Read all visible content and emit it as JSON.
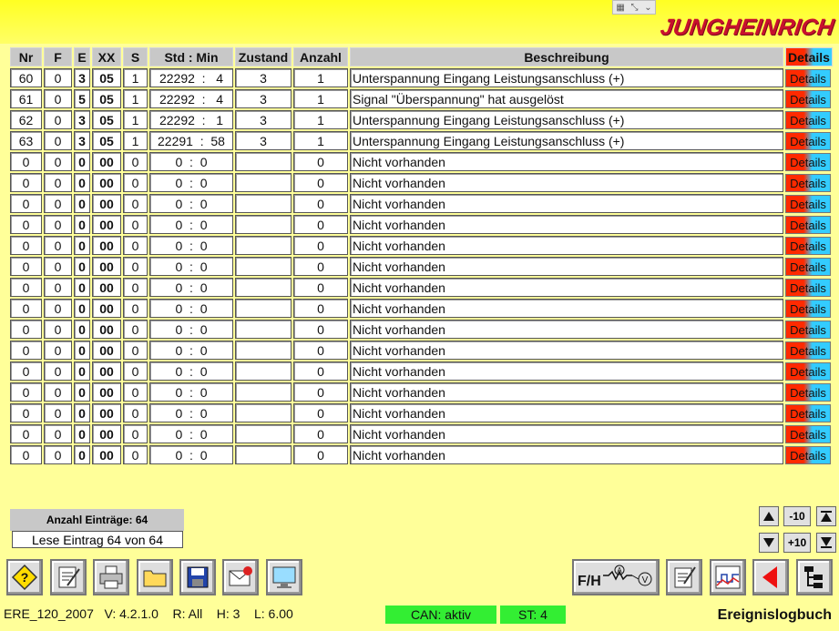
{
  "logo_text": "JUNGHEINRICH",
  "columns": {
    "nr": "Nr",
    "f": "F",
    "e": "E",
    "xx": "XX",
    "s": "S",
    "time": "Std : Min",
    "zustand": "Zustand",
    "anzahl": "Anzahl",
    "desc": "Beschreibung",
    "details": "Details"
  },
  "rows": [
    {
      "nr": "60",
      "f": "0",
      "e": "3",
      "xx": "05",
      "s": "1",
      "time": "22292  :   4",
      "zustand": "3",
      "anzahl": "1",
      "desc": "Unterspannung Eingang Leistungsanschluss (+)",
      "details": "Details"
    },
    {
      "nr": "61",
      "f": "0",
      "e": "5",
      "xx": "05",
      "s": "1",
      "time": "22292  :   4",
      "zustand": "3",
      "anzahl": "1",
      "desc": "Signal \"Überspannung\" hat ausgelöst",
      "details": "Details"
    },
    {
      "nr": "62",
      "f": "0",
      "e": "3",
      "xx": "05",
      "s": "1",
      "time": "22292  :   1",
      "zustand": "3",
      "anzahl": "1",
      "desc": "Unterspannung Eingang Leistungsanschluss (+)",
      "details": "Details"
    },
    {
      "nr": "63",
      "f": "0",
      "e": "3",
      "xx": "05",
      "s": "1",
      "time": "22291  :  58",
      "zustand": "3",
      "anzahl": "1",
      "desc": "Unterspannung Eingang Leistungsanschluss (+)",
      "details": "Details"
    },
    {
      "nr": "0",
      "f": "0",
      "e": "0",
      "xx": "00",
      "s": "0",
      "time": "0  :  0",
      "zustand": "",
      "anzahl": "0",
      "desc": "Nicht vorhanden",
      "details": "Details"
    },
    {
      "nr": "0",
      "f": "0",
      "e": "0",
      "xx": "00",
      "s": "0",
      "time": "0  :  0",
      "zustand": "",
      "anzahl": "0",
      "desc": "Nicht vorhanden",
      "details": "Details"
    },
    {
      "nr": "0",
      "f": "0",
      "e": "0",
      "xx": "00",
      "s": "0",
      "time": "0  :  0",
      "zustand": "",
      "anzahl": "0",
      "desc": "Nicht vorhanden",
      "details": "Details"
    },
    {
      "nr": "0",
      "f": "0",
      "e": "0",
      "xx": "00",
      "s": "0",
      "time": "0  :  0",
      "zustand": "",
      "anzahl": "0",
      "desc": "Nicht vorhanden",
      "details": "Details"
    },
    {
      "nr": "0",
      "f": "0",
      "e": "0",
      "xx": "00",
      "s": "0",
      "time": "0  :  0",
      "zustand": "",
      "anzahl": "0",
      "desc": "Nicht vorhanden",
      "details": "Details"
    },
    {
      "nr": "0",
      "f": "0",
      "e": "0",
      "xx": "00",
      "s": "0",
      "time": "0  :  0",
      "zustand": "",
      "anzahl": "0",
      "desc": "Nicht vorhanden",
      "details": "Details"
    },
    {
      "nr": "0",
      "f": "0",
      "e": "0",
      "xx": "00",
      "s": "0",
      "time": "0  :  0",
      "zustand": "",
      "anzahl": "0",
      "desc": "Nicht vorhanden",
      "details": "Details"
    },
    {
      "nr": "0",
      "f": "0",
      "e": "0",
      "xx": "00",
      "s": "0",
      "time": "0  :  0",
      "zustand": "",
      "anzahl": "0",
      "desc": "Nicht vorhanden",
      "details": "Details"
    },
    {
      "nr": "0",
      "f": "0",
      "e": "0",
      "xx": "00",
      "s": "0",
      "time": "0  :  0",
      "zustand": "",
      "anzahl": "0",
      "desc": "Nicht vorhanden",
      "details": "Details"
    },
    {
      "nr": "0",
      "f": "0",
      "e": "0",
      "xx": "00",
      "s": "0",
      "time": "0  :  0",
      "zustand": "",
      "anzahl": "0",
      "desc": "Nicht vorhanden",
      "details": "Details"
    },
    {
      "nr": "0",
      "f": "0",
      "e": "0",
      "xx": "00",
      "s": "0",
      "time": "0  :  0",
      "zustand": "",
      "anzahl": "0",
      "desc": "Nicht vorhanden",
      "details": "Details"
    },
    {
      "nr": "0",
      "f": "0",
      "e": "0",
      "xx": "00",
      "s": "0",
      "time": "0  :  0",
      "zustand": "",
      "anzahl": "0",
      "desc": "Nicht vorhanden",
      "details": "Details"
    },
    {
      "nr": "0",
      "f": "0",
      "e": "0",
      "xx": "00",
      "s": "0",
      "time": "0  :  0",
      "zustand": "",
      "anzahl": "0",
      "desc": "Nicht vorhanden",
      "details": "Details"
    },
    {
      "nr": "0",
      "f": "0",
      "e": "0",
      "xx": "00",
      "s": "0",
      "time": "0  :  0",
      "zustand": "",
      "anzahl": "0",
      "desc": "Nicht vorhanden",
      "details": "Details"
    },
    {
      "nr": "0",
      "f": "0",
      "e": "0",
      "xx": "00",
      "s": "0",
      "time": "0  :  0",
      "zustand": "",
      "anzahl": "0",
      "desc": "Nicht vorhanden",
      "details": "Details"
    }
  ],
  "summary": {
    "count_label": "Anzahl Einträge: 64",
    "read_label": "Lese Eintrag 64  von 64"
  },
  "nav": {
    "minus10": "-10",
    "plus10": "+10"
  },
  "toolbar": {
    "fh_label": "F/H"
  },
  "status": {
    "version": "ERE_120_2007   V: 4.2.1.0    R: All    H: 3    L: 6.00",
    "can": "CAN: aktiv",
    "st": "ST: 4",
    "screen_title": "Ereignislogbuch"
  },
  "colors": {
    "background": "#ffff99",
    "header_yellow": "#ffff22",
    "logo": "#c8102e",
    "ok_green": "#33ee33",
    "details_red": "#ff2a00",
    "details_cyan": "#33ccff"
  },
  "icons": [
    "help-icon",
    "edit-icon",
    "printer-icon",
    "folder-icon",
    "save-icon",
    "delete-mail-icon",
    "monitor-icon",
    "fh-meter-icon",
    "notepad-icon",
    "signal-graph-icon",
    "back-arrow-icon",
    "tree-icon"
  ]
}
